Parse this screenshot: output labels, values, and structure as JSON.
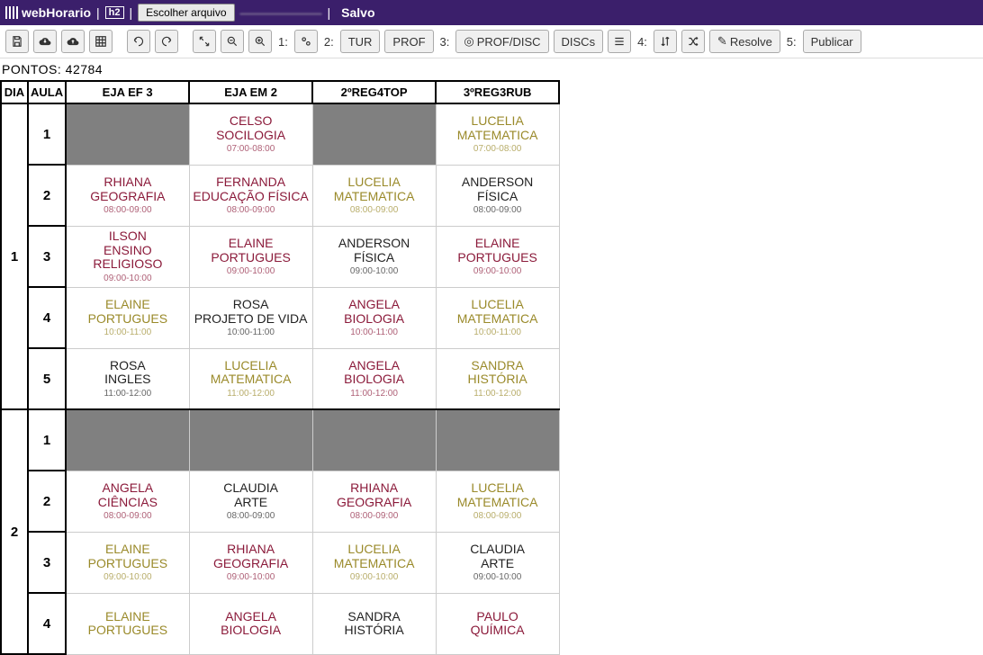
{
  "header": {
    "app_name": "webHorario",
    "h2": "h2",
    "choose_file": "Escolher arquivo",
    "file_name": "———————",
    "saved": "Salvo"
  },
  "toolbar": {
    "g1": "1:",
    "g2": "2:",
    "btn_tur": "TUR",
    "btn_prof": "PROF",
    "g3": "3:",
    "btn_profdisc": "PROF/DISC",
    "btn_discs": "DISCs",
    "g4": "4:",
    "btn_resolve": "Resolve",
    "g5": "5:",
    "btn_publicar": "Publicar"
  },
  "points": {
    "label": "PONTOS:",
    "value": "42784"
  },
  "head": {
    "dia": "DIA",
    "aula": "AULA",
    "cols": [
      "EJA EF 3",
      "EJA EM 2",
      "2ºREG4TOP",
      "3ºREG3RUB"
    ]
  },
  "days": [
    {
      "dia": "1",
      "rows": [
        {
          "aula": "1",
          "cells": [
            {
              "empty": true
            },
            {
              "cls": "c-maroon",
              "teacher": "CELSO",
              "subject": "SOCILOGIA",
              "time": "07:00-08:00"
            },
            {
              "empty": true
            },
            {
              "cls": "c-olive",
              "teacher": "LUCELIA",
              "subject": "MATEMATICA",
              "time": "07:00-08:00"
            }
          ]
        },
        {
          "aula": "2",
          "cells": [
            {
              "cls": "c-maroon",
              "teacher": "RHIANA",
              "subject": "GEOGRAFIA",
              "time": "08:00-09:00"
            },
            {
              "cls": "c-maroon",
              "teacher": "FERNANDA",
              "subject": "EDUCAÇÃO FÍSICA",
              "time": "08:00-09:00"
            },
            {
              "cls": "c-olive",
              "teacher": "LUCELIA",
              "subject": "MATEMATICA",
              "time": "08:00-09:00"
            },
            {
              "cls": "c-black",
              "teacher": "ANDERSON",
              "subject": "FÍSICA",
              "time": "08:00-09:00"
            }
          ]
        },
        {
          "aula": "3",
          "cells": [
            {
              "cls": "c-maroon",
              "teacher": "ILSON",
              "subject": "ENSINO RELIGIOSO",
              "time": "09:00-10:00"
            },
            {
              "cls": "c-maroon",
              "teacher": "ELAINE",
              "subject": "PORTUGUES",
              "time": "09:00-10:00"
            },
            {
              "cls": "c-black",
              "teacher": "ANDERSON",
              "subject": "FÍSICA",
              "time": "09:00-10:00"
            },
            {
              "cls": "c-maroon",
              "teacher": "ELAINE",
              "subject": "PORTUGUES",
              "time": "09:00-10:00"
            }
          ]
        },
        {
          "aula": "4",
          "cells": [
            {
              "cls": "c-olive",
              "teacher": "ELAINE",
              "subject": "PORTUGUES",
              "time": "10:00-11:00"
            },
            {
              "cls": "c-black",
              "teacher": "ROSA",
              "subject": "PROJETO DE VIDA",
              "time": "10:00-11:00"
            },
            {
              "cls": "c-maroon",
              "teacher": "ANGELA",
              "subject": "BIOLOGIA",
              "time": "10:00-11:00"
            },
            {
              "cls": "c-olive",
              "teacher": "LUCELIA",
              "subject": "MATEMATICA",
              "time": "10:00-11:00"
            }
          ]
        },
        {
          "aula": "5",
          "cells": [
            {
              "cls": "c-black",
              "teacher": "ROSA",
              "subject": "INGLES",
              "time": "11:00-12:00"
            },
            {
              "cls": "c-olive",
              "teacher": "LUCELIA",
              "subject": "MATEMATICA",
              "time": "11:00-12:00"
            },
            {
              "cls": "c-maroon",
              "teacher": "ANGELA",
              "subject": "BIOLOGIA",
              "time": "11:00-12:00"
            },
            {
              "cls": "c-olive",
              "teacher": "SANDRA",
              "subject": "HISTÓRIA",
              "time": "11:00-12:00"
            }
          ]
        }
      ]
    },
    {
      "dia": "2",
      "rows": [
        {
          "aula": "1",
          "cells": [
            {
              "empty": true
            },
            {
              "empty": true
            },
            {
              "empty": true
            },
            {
              "empty": true
            }
          ]
        },
        {
          "aula": "2",
          "cells": [
            {
              "cls": "c-maroon",
              "teacher": "ANGELA",
              "subject": "CIÊNCIAS",
              "time": "08:00-09:00"
            },
            {
              "cls": "c-black",
              "teacher": "CLAUDIA",
              "subject": "ARTE",
              "time": "08:00-09:00"
            },
            {
              "cls": "c-maroon",
              "teacher": "RHIANA",
              "subject": "GEOGRAFIA",
              "time": "08:00-09:00"
            },
            {
              "cls": "c-olive",
              "teacher": "LUCELIA",
              "subject": "MATEMATICA",
              "time": "08:00-09:00"
            }
          ]
        },
        {
          "aula": "3",
          "cells": [
            {
              "cls": "c-olive",
              "teacher": "ELAINE",
              "subject": "PORTUGUES",
              "time": "09:00-10:00"
            },
            {
              "cls": "c-maroon",
              "teacher": "RHIANA",
              "subject": "GEOGRAFIA",
              "time": "09:00-10:00"
            },
            {
              "cls": "c-olive",
              "teacher": "LUCELIA",
              "subject": "MATEMATICA",
              "time": "09:00-10:00"
            },
            {
              "cls": "c-black",
              "teacher": "CLAUDIA",
              "subject": "ARTE",
              "time": "09:00-10:00"
            }
          ]
        },
        {
          "aula": "4",
          "cells": [
            {
              "cls": "c-olive",
              "teacher": "ELAINE",
              "subject": "PORTUGUES",
              "time": ""
            },
            {
              "cls": "c-maroon",
              "teacher": "ANGELA",
              "subject": "BIOLOGIA",
              "time": ""
            },
            {
              "cls": "c-black",
              "teacher": "SANDRA",
              "subject": "HISTÓRIA",
              "time": ""
            },
            {
              "cls": "c-maroon",
              "teacher": "PAULO",
              "subject": "QUÍMICA",
              "time": ""
            }
          ]
        }
      ]
    }
  ]
}
